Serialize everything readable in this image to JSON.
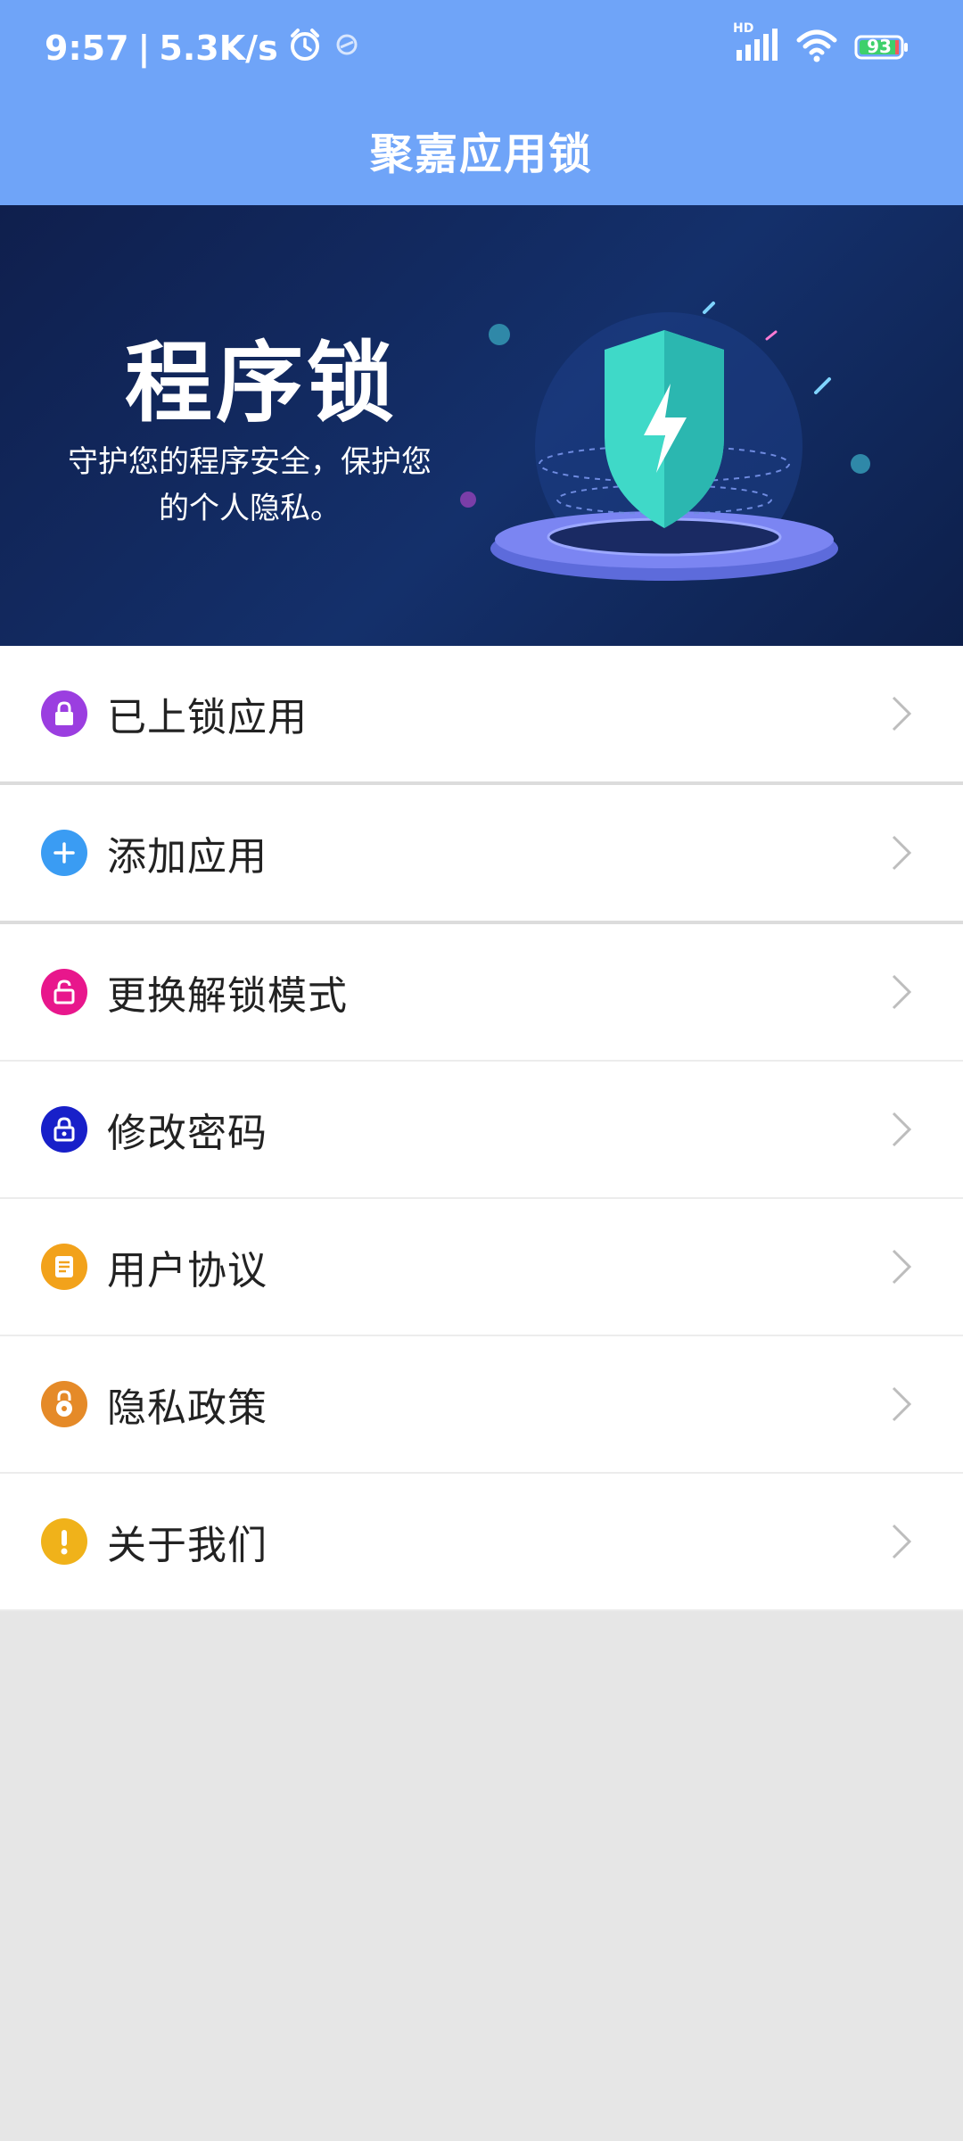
{
  "status_bar": {
    "time": "9:57",
    "separator": "|",
    "speed": "5.3K/s",
    "network_label": "HD",
    "battery": "93"
  },
  "app_bar": {
    "title": "聚嘉应用锁"
  },
  "banner": {
    "title": "程序锁",
    "subtitle": "守护您的程序安全，保护您的个人隐私。"
  },
  "menu": {
    "items": [
      {
        "label": "已上锁应用",
        "icon": "lock-icon",
        "color": "#9b3ee0"
      },
      {
        "label": "添加应用",
        "icon": "plus-icon",
        "color": "#3a9cf3"
      },
      {
        "label": "更换解锁模式",
        "icon": "unlock-icon",
        "color": "#e8178c"
      },
      {
        "label": "修改密码",
        "icon": "lock-icon",
        "color": "#1820c9"
      },
      {
        "label": "用户协议",
        "icon": "document-icon",
        "color": "#f2a21b"
      },
      {
        "label": "隐私政策",
        "icon": "padlock-icon",
        "color": "#e58a28"
      },
      {
        "label": "关于我们",
        "icon": "exclamation-icon",
        "color": "#f0b21a"
      }
    ]
  }
}
